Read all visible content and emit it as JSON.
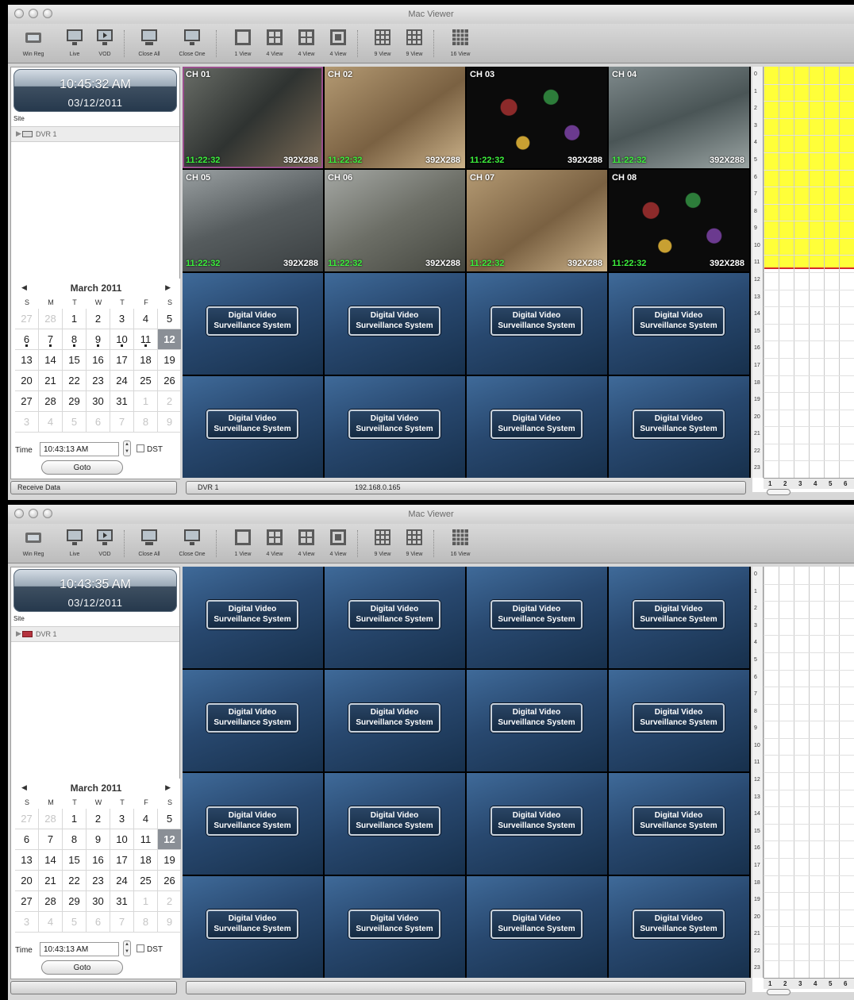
{
  "app_title": "Mac Viewer",
  "colors": {
    "timeline_record": "#ffff39",
    "timeline_marker": "#d52a2a",
    "camera_time": "#3cf03c",
    "selected_day": "#8a8f96"
  },
  "toolbar_labels": {
    "win_reg": "Win Reg",
    "live": "Live",
    "vod": "VOD",
    "close_all": "Close All",
    "close_one": "Close One",
    "view_1": "1 View",
    "view_4a": "4 View",
    "view_4b": "4 View",
    "view_4c": "4 View",
    "view_9a": "9 View",
    "view_9b": "9 View",
    "view_16": "16 View"
  },
  "common": {
    "site_label": "Site",
    "time_label": "Time",
    "dst_label": "DST",
    "goto_label": "Goto",
    "logo_line1": "Digital Video",
    "logo_line2": "Surveillance System",
    "timestamp": "11:22:32",
    "resolution": "392X288",
    "month": "March 2011",
    "dow": [
      "S",
      "M",
      "T",
      "W",
      "T",
      "F",
      "S"
    ],
    "days": [
      "27",
      "28",
      "1",
      "2",
      "3",
      "4",
      "5",
      "6",
      "7",
      "8",
      "9",
      "10",
      "11",
      "12",
      "13",
      "14",
      "15",
      "16",
      "17",
      "18",
      "19",
      "20",
      "21",
      "22",
      "23",
      "24",
      "25",
      "26",
      "27",
      "28",
      "29",
      "30",
      "31",
      "1",
      "2",
      "3",
      "4",
      "5",
      "6",
      "7",
      "8",
      "9"
    ],
    "hours": [
      "0",
      "1",
      "2",
      "3",
      "4",
      "5",
      "6",
      "7",
      "8",
      "9",
      "10",
      "11",
      "12",
      "13",
      "14",
      "15",
      "16",
      "17",
      "18",
      "19",
      "20",
      "21",
      "22",
      "23"
    ],
    "channels": [
      "1",
      "2",
      "3",
      "4",
      "5",
      "6"
    ]
  },
  "window1": {
    "clock_time": "10:45:32 AM",
    "clock_date": "03/12/2011",
    "site_name": "DVR 1",
    "time_value": "10:43:13 AM",
    "status_left": "Receive Data",
    "status_dvr": "DVR 1",
    "status_ip": "192.168.0.165",
    "cameras": [
      "CH 01",
      "CH 02",
      "CH 03",
      "CH 04",
      "CH 05",
      "CH 06",
      "CH 07",
      "CH 08"
    ]
  },
  "window2": {
    "clock_time": "10:43:35 AM",
    "clock_date": "03/12/2011",
    "site_name": "DVR 1",
    "time_value": "10:43:13 AM"
  }
}
